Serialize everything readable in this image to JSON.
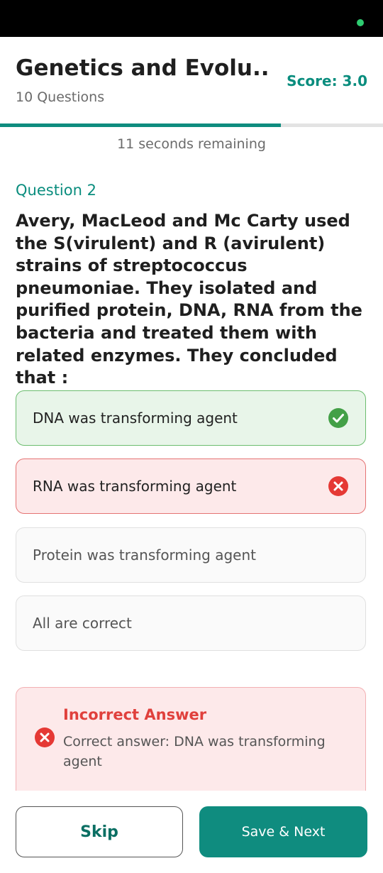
{
  "header": {
    "title": "Genetics and Evolu...",
    "subtitle": "10 Questions",
    "score": "Score: 3.0"
  },
  "progress": {
    "fraction": 0.733
  },
  "timer": {
    "text": "11 seconds remaining"
  },
  "question": {
    "number_label": "Question 2",
    "text": "Avery, MacLeod and Mc Carty used the S(virulent) and R (avirulent) strains of streptococcus pneumoniae. They isolated and purified protein, DNA, RNA from the bacteria and treated them with related enzymes. They concluded that :"
  },
  "options": [
    {
      "label": "DNA was transforming agent",
      "state": "correct"
    },
    {
      "label": "RNA was transforming agent",
      "state": "wrong"
    },
    {
      "label": "Protein was transforming agent",
      "state": "neutral"
    },
    {
      "label": "All are correct",
      "state": "neutral"
    }
  ],
  "feedback": {
    "title": "Incorrect Answer",
    "text": "Correct answer: DNA was transforming agent",
    "icon": "error-circle-icon"
  },
  "buttons": {
    "skip_label": "Skip",
    "next_label": "Save & Next"
  },
  "colors": {
    "accent": "#0f8c7f",
    "correct": "#4caf50",
    "wrong": "#e53935"
  }
}
